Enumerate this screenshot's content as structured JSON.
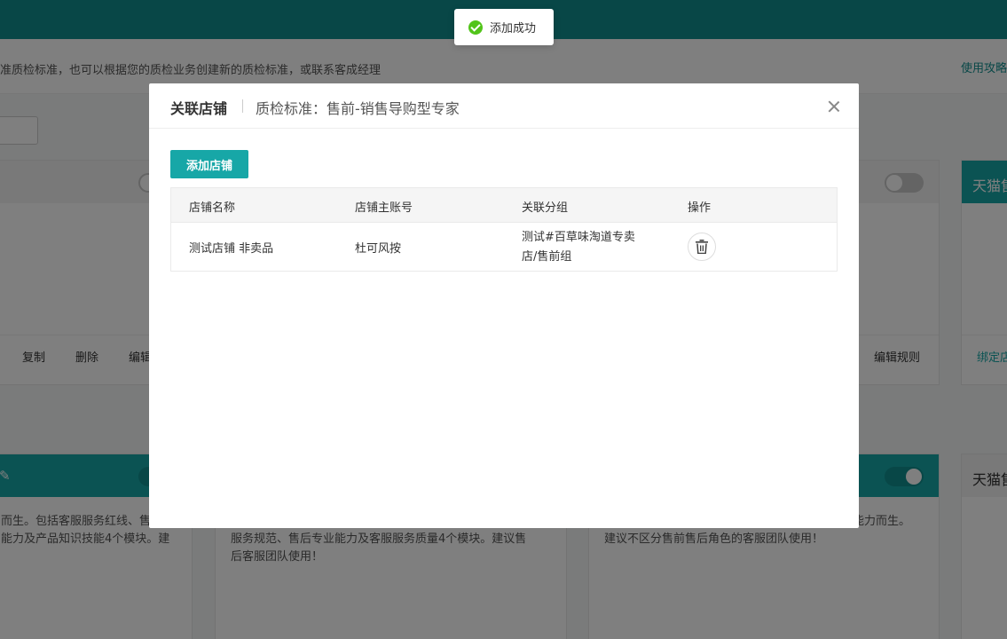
{
  "background": {
    "notice_text": "准质检标准，也可以根据您的质检业务创建新的质检标准，或联系客成经理",
    "guide_link": "使用攻略",
    "cards": {
      "card1_actions": [
        "复制",
        "删除",
        "编辑"
      ],
      "card2_action": "编辑规则",
      "card3_title": "天猫售",
      "card3_action": "绑定店",
      "card4_desc": [
        "而生。包括客服服务红线、售",
        "能力及产品知识技能4个模块。建"
      ],
      "card5_desc": [
        "服务规范、售后专业能力及客服服务质量4个模块。建议售",
        "后客服团队使用！"
      ],
      "card6_desc": [
        "能力而生。",
        "建议不区分售前售后角色的客服团队使用！"
      ],
      "card7_title": "天猫售"
    }
  },
  "toast": {
    "icon": "check-circle-icon",
    "text": "添加成功",
    "color": "#52c41a"
  },
  "modal": {
    "title": "关联店铺",
    "subtitle": "质检标准：售前-销售导购型专家",
    "add_button": "添加店铺",
    "accent": "#17a7a7",
    "table": {
      "headers": [
        "店铺名称",
        "店铺主账号",
        "关联分组",
        "操作"
      ],
      "rows": [
        {
          "shop_name": "测试店铺 非卖品",
          "main_account": "杜可风按",
          "group_line1": "测试#百草味淘道专卖",
          "group_line2": "店/售前组",
          "action_icon": "trash-icon"
        }
      ]
    }
  }
}
